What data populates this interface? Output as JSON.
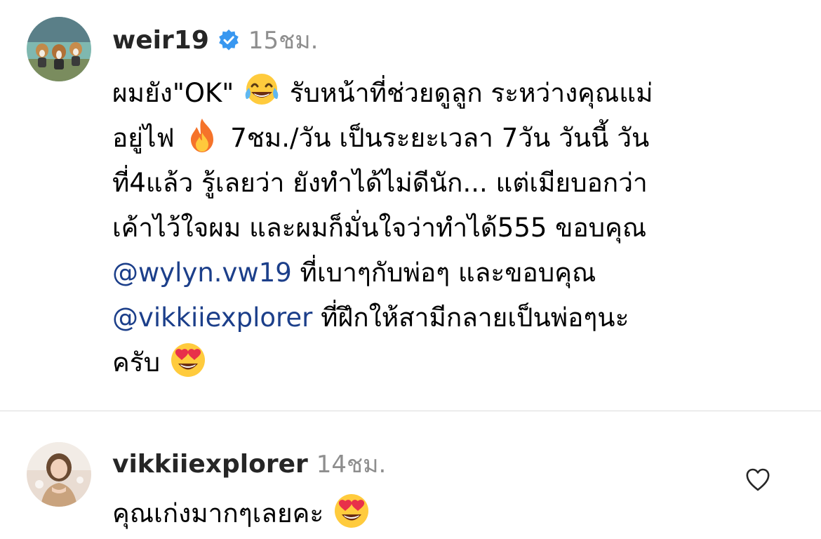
{
  "post": {
    "username": "weir19",
    "timestamp": "15ชม.",
    "avatar_icon": "dogs-avatar-icon",
    "verified_icon": "verified-badge-icon",
    "verified_color": "#3897f0",
    "caption_lines": [
      {
        "a": "ผมยัง\"OK\"",
        "b": "รับหน้าที่ช่วยดูลูก ระหว่างคุณแม่"
      },
      {
        "a": "อยู่ไฟ",
        "b": "7ชม./วัน เป็นระยะเวลา 7วัน วันนี้ วัน"
      },
      {
        "a": "ที่4แล้ว รู้เลยว่า ยังทำได้ไม่ดีนัก... แต่เมียบอกว่า"
      },
      {
        "a": "เค้าไว้ใจผม และผมก็มั่นใจว่าทำได้555 ขอบคุณ"
      },
      {
        "mention": "@wylyn.vw19",
        "b": " ที่เบาๆกับพ่อๆ และขอบคุณ"
      },
      {
        "mention": "@vikkiiexplorer",
        "b": " ที่ฝึกให้สามีกลายเป็นพ่อๆนะ"
      },
      {
        "a": "ครับ"
      }
    ],
    "emojis": [
      "tears-of-joy-emoji-icon",
      "fire-emoji-icon",
      "heart-eyes-emoji-icon"
    ]
  },
  "comment": {
    "username": "vikkiiexplorer",
    "timestamp": "14ชม.",
    "text": "คุณเก่งมากๆเลยคะ",
    "avatar_icon": "woman-avatar-icon",
    "like_icon": "heart-outline-icon",
    "emoji": "heart-eyes-emoji-icon"
  },
  "colors": {
    "username": "#262626",
    "timestamp": "#8e8e8e",
    "mention": "#1c3f8a",
    "divider": "#dbdbdb"
  }
}
